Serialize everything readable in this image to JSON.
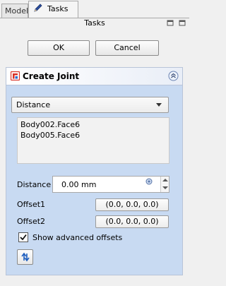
{
  "tabs": [
    {
      "label": "Model"
    },
    {
      "label": "Tasks"
    }
  ],
  "panel": {
    "title": "Tasks"
  },
  "buttons": {
    "ok": "OK",
    "cancel": "Cancel"
  },
  "taskbox": {
    "title": "Create Joint",
    "joint_type": "Distance",
    "selection": [
      "Body002.Face6",
      "Body005.Face6"
    ],
    "distance": {
      "label": "Distance",
      "value": "0.00 mm"
    },
    "offset1": {
      "label": "Offset1",
      "value": "(0.0, 0.0, 0.0)"
    },
    "offset2": {
      "label": "Offset2",
      "value": "(0.0, 0.0, 0.0)"
    },
    "show_advanced": {
      "label": "Show advanced offsets",
      "checked": true
    }
  },
  "icons": [
    "pencil-icon",
    "float-icon",
    "close-icon",
    "create-joint-icon",
    "collapse-icon",
    "dropdown-arrow-icon",
    "unit-expression-icon",
    "spin-up-icon",
    "spin-down-icon",
    "checkmark-icon",
    "reverse-icon"
  ],
  "colors": {
    "taskbox_bg": "#c8daf2",
    "joint_icon_red": "#d93025"
  }
}
